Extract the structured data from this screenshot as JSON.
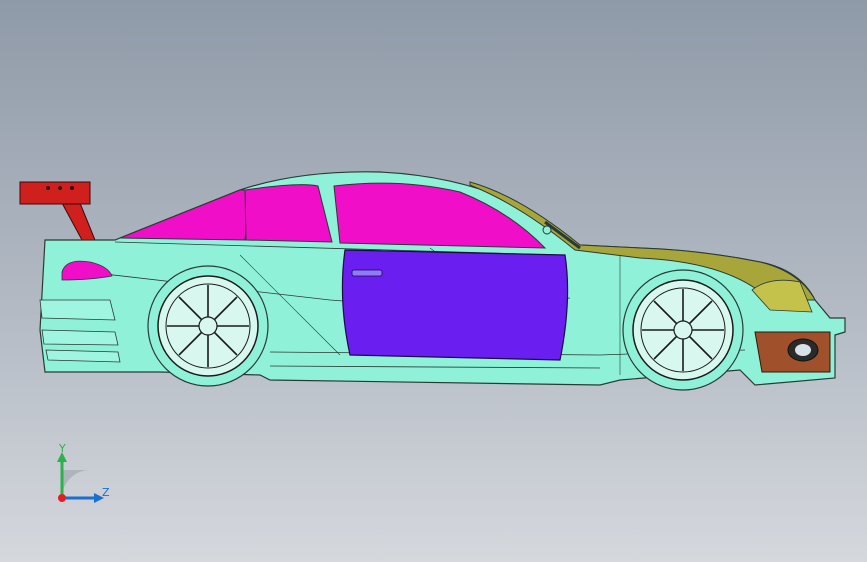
{
  "viewport": {
    "background_top": "#8f9aa8",
    "background_bottom": "#d5d8dd"
  },
  "model": {
    "body_color": "#8ff2d8",
    "roof_glass_color": "#f00ec8",
    "door_color": "#6a1ff0",
    "hood_color": "#a8a63a",
    "wing_color": "#d0201e",
    "bumper_color": "#a0502a"
  },
  "triad": {
    "y_label": "Y",
    "z_label": "Z",
    "y_color": "#2bb24b",
    "z_color": "#1a6fd0",
    "origin_color": "#e02020"
  }
}
